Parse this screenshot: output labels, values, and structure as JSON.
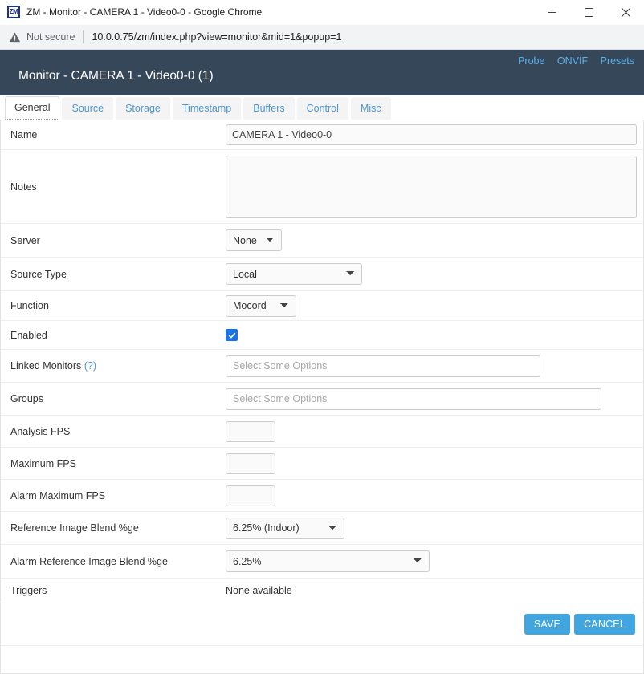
{
  "browser": {
    "window_title": "ZM - Monitor - CAMERA 1 - Video0-0 - Google Chrome",
    "logo_text": "ZM",
    "security_label": "Not secure",
    "url": "10.0.0.75/zm/index.php?view=monitor&mid=1&popup=1",
    "minimize_label": "Minimize",
    "maximize_label": "Maximize",
    "close_label": "Close"
  },
  "header": {
    "title": "Monitor - CAMERA 1 - Video0-0 (1)",
    "links": [
      {
        "label": "Probe"
      },
      {
        "label": "ONVIF"
      },
      {
        "label": "Presets"
      }
    ],
    "background_color": "#37475a",
    "link_color": "#5bb0e8"
  },
  "tabs": [
    {
      "label": "General",
      "active": true
    },
    {
      "label": "Source",
      "active": false
    },
    {
      "label": "Storage",
      "active": false
    },
    {
      "label": "Timestamp",
      "active": false
    },
    {
      "label": "Buffers",
      "active": false
    },
    {
      "label": "Control",
      "active": false
    },
    {
      "label": "Misc",
      "active": false
    }
  ],
  "form": {
    "name": {
      "label": "Name",
      "value": "CAMERA 1 - Video0-0"
    },
    "notes": {
      "label": "Notes",
      "value": "",
      "placeholder": ""
    },
    "server": {
      "label": "Server",
      "value": "None",
      "options": [
        "None"
      ]
    },
    "source_type": {
      "label": "Source Type",
      "value": "Local",
      "options": [
        "Local"
      ]
    },
    "function": {
      "label": "Function",
      "value": "Mocord",
      "options": [
        "Mocord"
      ]
    },
    "enabled": {
      "label": "Enabled",
      "checked": true
    },
    "linked_monitors": {
      "label": "Linked Monitors",
      "hint": "(?)",
      "placeholder": "Select Some Options",
      "value": ""
    },
    "groups": {
      "label": "Groups",
      "placeholder": "Select Some Options",
      "value": ""
    },
    "analysis_fps": {
      "label": "Analysis FPS",
      "value": ""
    },
    "maximum_fps": {
      "label": "Maximum FPS",
      "value": ""
    },
    "alarm_maximum_fps": {
      "label": "Alarm Maximum FPS",
      "value": ""
    },
    "reference_image_blend": {
      "label": "Reference Image Blend %ge",
      "value": "6.25% (Indoor)",
      "options": [
        "6.25% (Indoor)"
      ]
    },
    "alarm_reference_image_blend": {
      "label": "Alarm Reference Image Blend %ge",
      "value": "6.25%",
      "options": [
        "6.25%"
      ]
    },
    "triggers": {
      "label": "Triggers",
      "value": "None available"
    }
  },
  "footer": {
    "save_label": "SAVE",
    "cancel_label": "CANCEL",
    "button_color": "#41a5e0"
  }
}
